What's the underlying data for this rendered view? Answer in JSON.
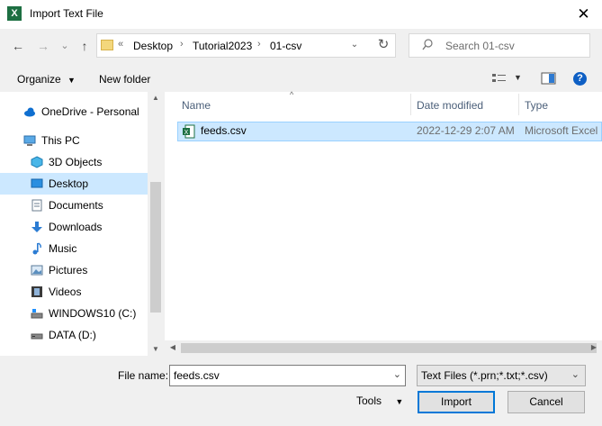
{
  "window": {
    "title": "Import Text File",
    "app_icon_letter": "X",
    "close": "✕"
  },
  "nav": {
    "back": "←",
    "forward": "→",
    "recent": "⌄",
    "up": "↑",
    "breadcrumb": [
      "Desktop",
      "Tutorial2023",
      "01-csv"
    ],
    "overflow": "«",
    "separator": "›",
    "dropdown": "⌄",
    "refresh": "↻"
  },
  "search": {
    "placeholder": "Search 01-csv"
  },
  "toolbar": {
    "organize": "Organize",
    "new_folder": "New folder",
    "help": "?"
  },
  "sidebar": {
    "items": [
      {
        "label": "OneDrive - Personal",
        "icon": "cloud-icon"
      },
      {
        "label": "This PC",
        "icon": "computer-icon"
      },
      {
        "label": "3D Objects",
        "icon": "cube-icon"
      },
      {
        "label": "Desktop",
        "icon": "desktop-icon",
        "selected": true
      },
      {
        "label": "Documents",
        "icon": "document-icon"
      },
      {
        "label": "Downloads",
        "icon": "download-icon"
      },
      {
        "label": "Music",
        "icon": "music-icon"
      },
      {
        "label": "Pictures",
        "icon": "picture-icon"
      },
      {
        "label": "Videos",
        "icon": "video-icon"
      },
      {
        "label": "WINDOWS10 (C:)",
        "icon": "drive-icon"
      },
      {
        "label": "DATA (D:)",
        "icon": "drive-icon"
      }
    ]
  },
  "filelist": {
    "columns": [
      "Name",
      "Date modified",
      "Type"
    ],
    "rows": [
      {
        "name": "feeds.csv",
        "date": "2022-12-29 2:07 AM",
        "type": "Microsoft Excel"
      }
    ]
  },
  "footer": {
    "file_name_label": "File name:",
    "file_name_value": "feeds.csv",
    "file_type": "Text Files (*.prn;*.txt;*.csv)",
    "tools": "Tools",
    "import": "Import",
    "cancel": "Cancel"
  },
  "colors": {
    "accent": "#0078d7",
    "selection": "#cce8ff",
    "excel_green": "#1d6f42"
  }
}
